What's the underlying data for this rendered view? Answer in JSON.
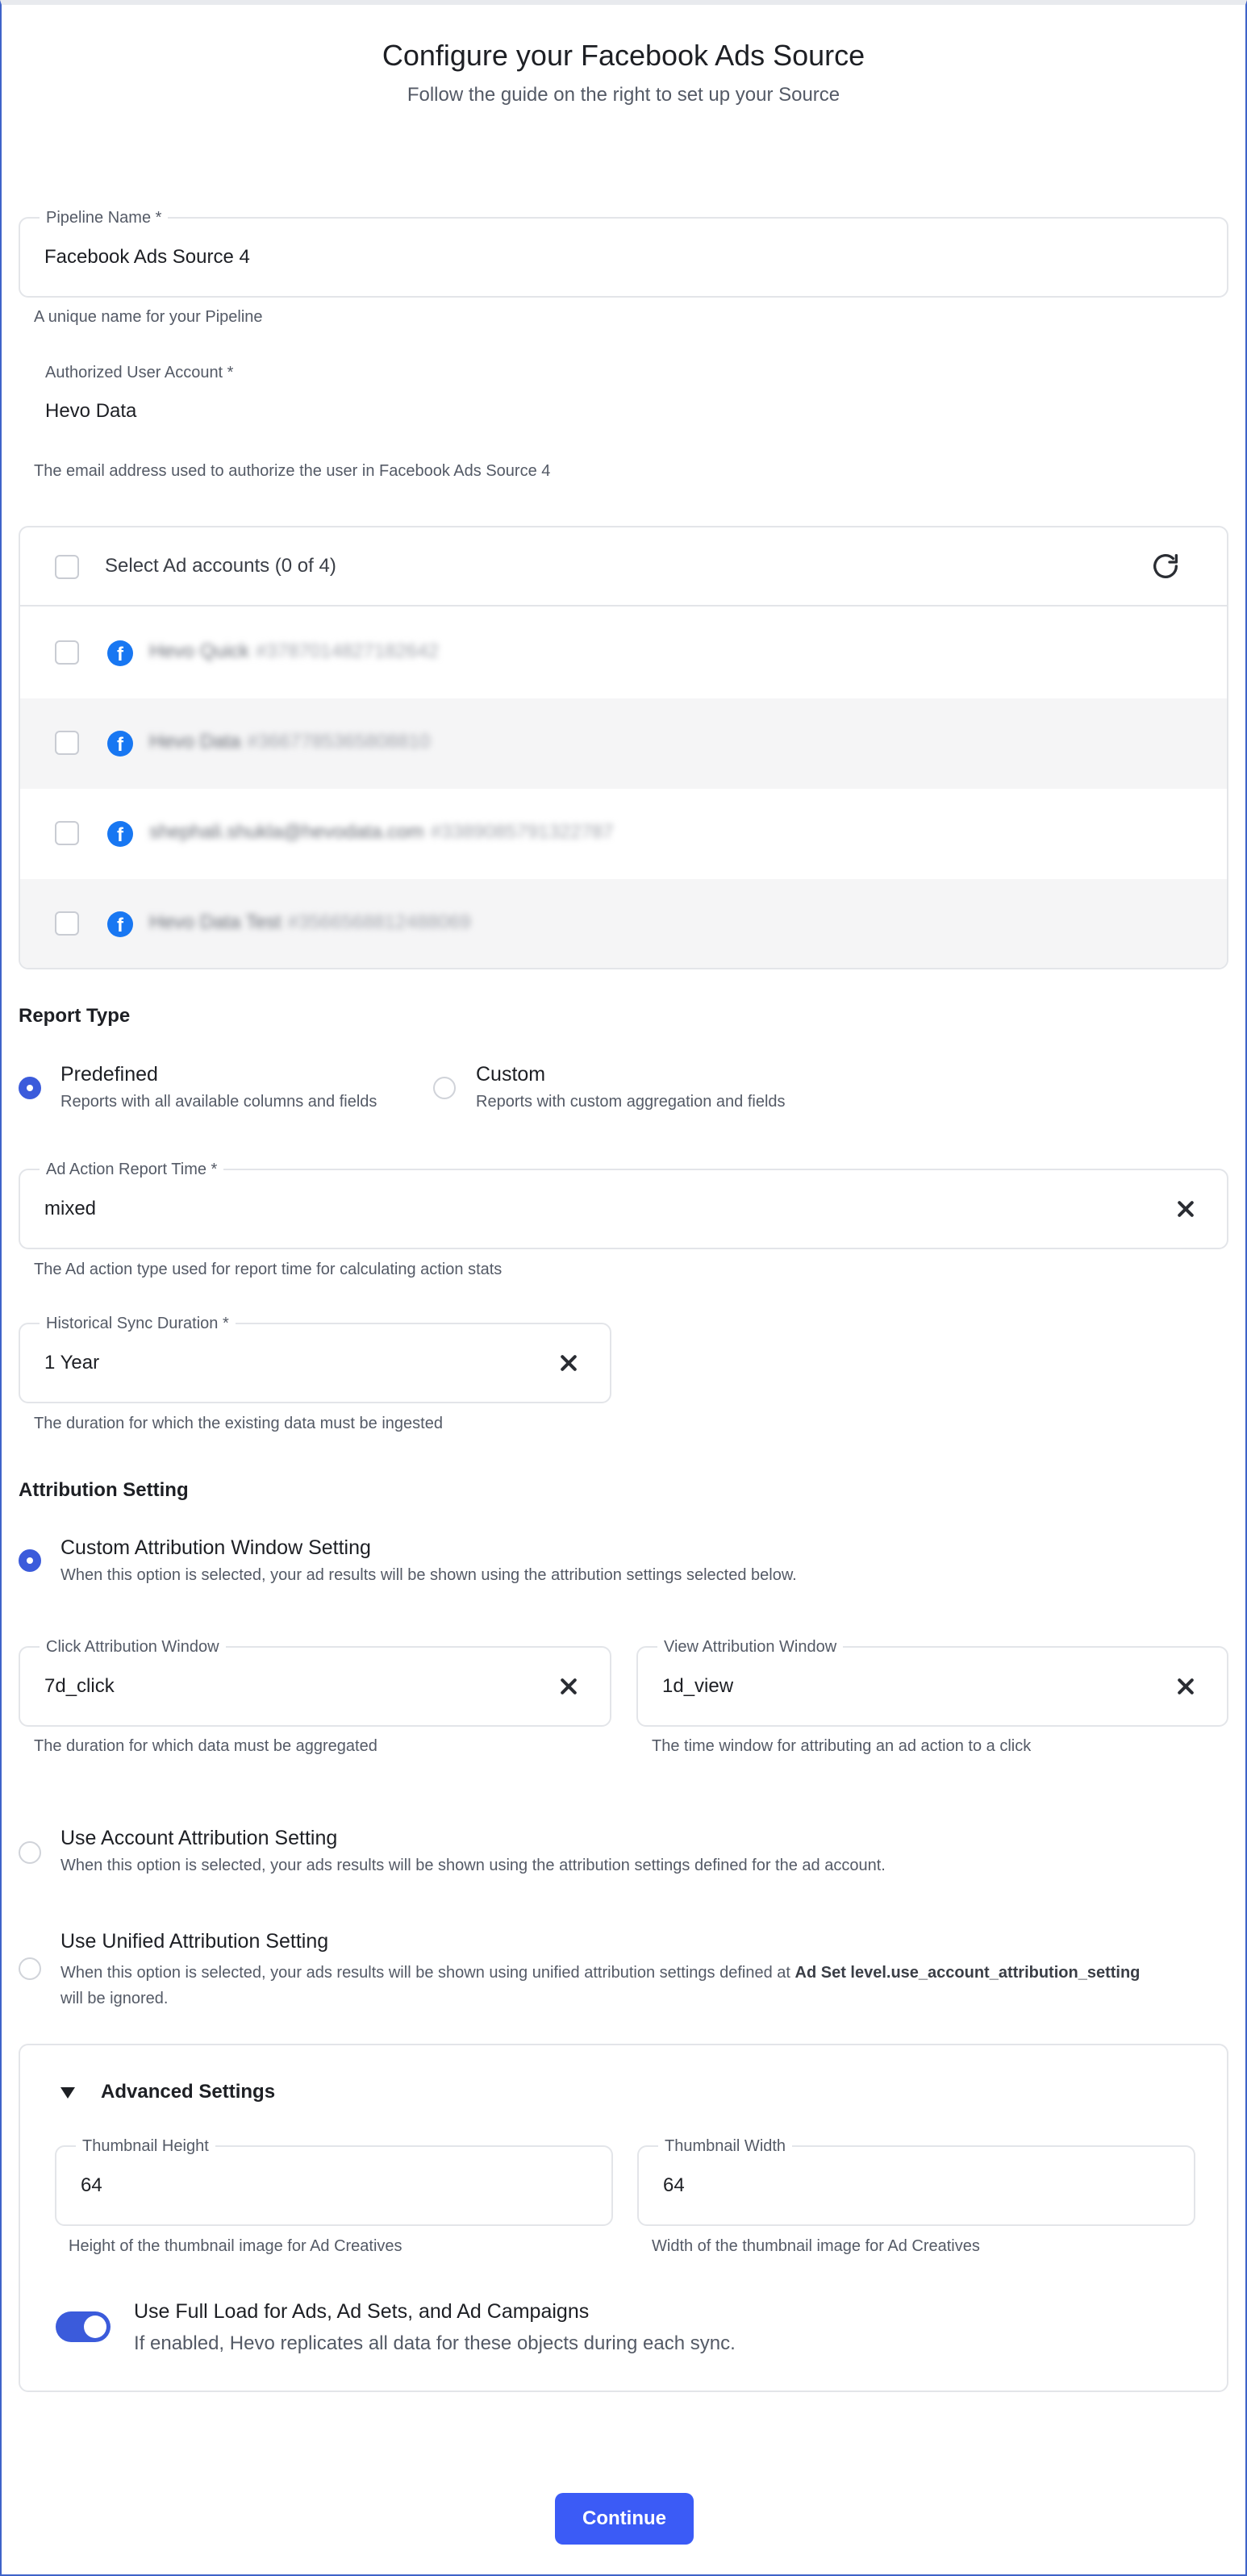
{
  "header": {
    "title": "Configure your Facebook Ads Source",
    "subtitle": "Follow the guide on the right to set up your Source"
  },
  "pipeline": {
    "label": "Pipeline Name *",
    "value": "Facebook Ads Source 4",
    "helper": "A unique name for your Pipeline"
  },
  "authorized": {
    "label": "Authorized User Account *",
    "value": "Hevo Data",
    "helper": "The email address used to authorize the user in Facebook Ads Source 4"
  },
  "accounts": {
    "header": "Select Ad accounts (0 of 4)",
    "refresh_icon": "refresh-icon",
    "items": [
      {
        "name": "Hevo Quick",
        "id": "#3787014827182642"
      },
      {
        "name": "Hevo Data",
        "id": "#3667785365808810"
      },
      {
        "name": "shephali.shukla@hevodata.com",
        "id": "#3389085791322787"
      },
      {
        "name": "Hevo Data Test",
        "id": "#3566568812488069"
      }
    ]
  },
  "report_type": {
    "title": "Report Type",
    "predefined": {
      "title": "Predefined",
      "desc": "Reports with all available columns and fields",
      "selected": true
    },
    "custom": {
      "title": "Custom",
      "desc": "Reports with custom aggregation and fields",
      "selected": false
    }
  },
  "ad_action": {
    "label": "Ad Action Report Time *",
    "value": "mixed",
    "helper": "The Ad action type used for report time for calculating action stats"
  },
  "historical": {
    "label": "Historical Sync Duration *",
    "value": "1 Year",
    "helper": "The duration for which the existing data must be ingested"
  },
  "attribution": {
    "title": "Attribution Setting",
    "custom": {
      "title": "Custom Attribution Window Setting",
      "desc": "When this option is selected, your ad results will be shown using the attribution settings selected below.",
      "selected": true
    },
    "click": {
      "label": "Click Attribution Window",
      "value": "7d_click",
      "helper": "The duration for which data must be aggregated"
    },
    "view": {
      "label": "View Attribution Window",
      "value": "1d_view",
      "helper": "The time window for attributing an ad action to a click"
    },
    "account": {
      "title": "Use Account Attribution Setting",
      "desc": "When this option is selected, your ads results will be shown using the attribution settings defined for the ad account.",
      "selected": false
    },
    "unified": {
      "title": "Use Unified Attribution Setting",
      "desc_prefix": "When this option is selected, your ads results will be shown using unified attribution settings defined at ",
      "desc_bold": "Ad Set level.use_account_attribution_setting",
      "desc_suffix": "will be ignored.",
      "selected": false
    }
  },
  "advanced": {
    "title": "Advanced Settings",
    "thumb_height": {
      "label": "Thumbnail Height",
      "value": "64",
      "helper": "Height of the thumbnail image for Ad Creatives"
    },
    "thumb_width": {
      "label": "Thumbnail Width",
      "value": "64",
      "helper": "Width of the thumbnail image for Ad Creatives"
    },
    "full_load": {
      "title": "Use Full Load for Ads, Ad Sets, and Ad Campaigns",
      "desc": "If enabled, Hevo replicates all data for these objects during each sync.",
      "enabled": true
    }
  },
  "footer": {
    "continue_label": "Continue"
  },
  "colors": {
    "accent": "#3b5bf6",
    "facebook": "#1877f2",
    "frame": "#3f63c9"
  }
}
